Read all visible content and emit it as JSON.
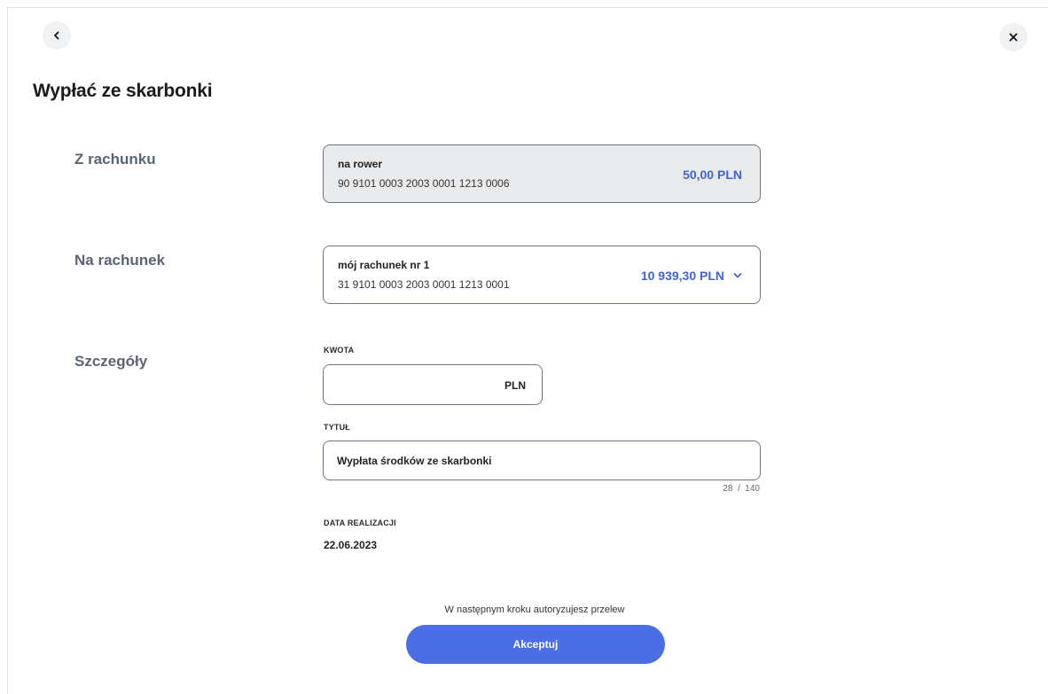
{
  "header": {
    "back_icon": "chevron-left-icon",
    "close_icon": "close-icon"
  },
  "page": {
    "title": "Wypłać ze skarbonki"
  },
  "from_account": {
    "section_label": "Z rachunku",
    "name": "na rower",
    "number": "90 9101 0003 2003 0001 1213 0006",
    "balance": "50,00 PLN"
  },
  "to_account": {
    "section_label": "Na rachunek",
    "name": "mój rachunek nr 1",
    "number": "31 9101 0003 2003 0001 1213 0001",
    "balance": "10 939,30 PLN",
    "dropdown_icon": "chevron-down-icon"
  },
  "details": {
    "section_label": "Szczegóły",
    "amount_label": "KWOTA",
    "amount_value": "",
    "amount_currency": "PLN",
    "title_label": "TYTUŁ",
    "title_value": "Wypłata środków ze skarbonki",
    "title_counter": "28  /  140",
    "date_label": "DATA REALIZACJI",
    "date_value": "22.06.2023"
  },
  "footer": {
    "auth_note": "W następnym kroku autoryzujesz przelew",
    "accept_label": "Akceptuj"
  },
  "colors": {
    "accent": "#4a6ee6",
    "balance_text": "#3d64d9",
    "section_label": "#5b6474"
  }
}
